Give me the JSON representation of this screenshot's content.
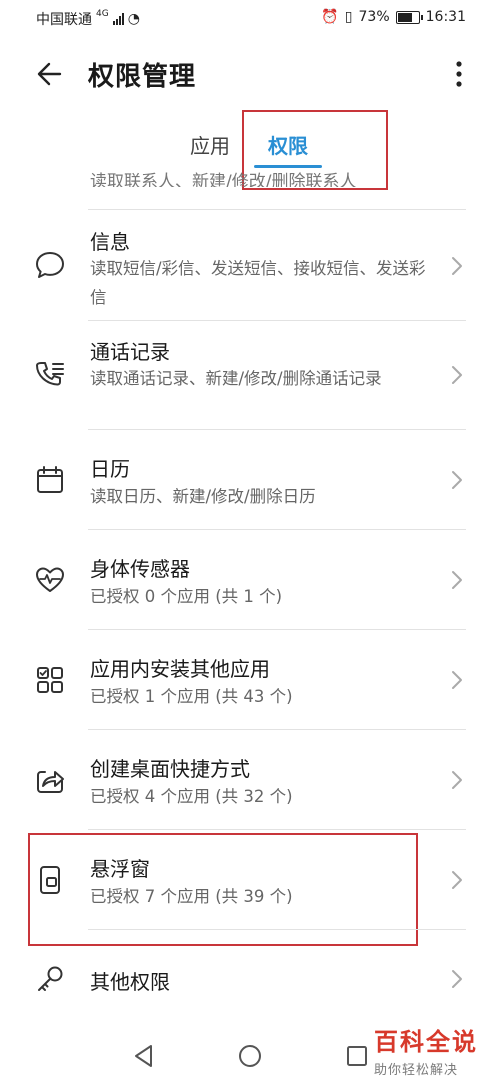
{
  "status_bar": {
    "carrier": "中国联通",
    "network": "4G",
    "battery": "73%",
    "battery_level": 0.73,
    "time": "16:31"
  },
  "header": {
    "title": "权限管理"
  },
  "tabs": [
    {
      "label": "应用",
      "selected": false
    },
    {
      "label": "权限",
      "selected": true
    }
  ],
  "list": {
    "cut_off_text": "读取联系人、新建/修改/删除联系人",
    "items": [
      {
        "icon": "message-icon",
        "title": "信息",
        "desc": "读取短信/彩信、发送短信、接收短信、发送彩信"
      },
      {
        "icon": "call-log-icon",
        "title": "通话记录",
        "desc": "读取通话记录、新建/修改/删除通话记录"
      },
      {
        "icon": "calendar-icon",
        "title": "日历",
        "desc": "读取日历、新建/修改/删除日历"
      },
      {
        "icon": "heart-sensor-icon",
        "title": "身体传感器",
        "desc": "已授权 0 个应用 (共 1 个)"
      },
      {
        "icon": "apps-grid-icon",
        "title": "应用内安装其他应用",
        "desc": "已授权 1 个应用 (共 43 个)"
      },
      {
        "icon": "shortcut-icon",
        "title": "创建桌面快捷方式",
        "desc": "已授权 4 个应用 (共 32 个)"
      },
      {
        "icon": "floating-window-icon",
        "title": "悬浮窗",
        "desc": "已授权 7 个应用 (共 39 个)"
      },
      {
        "icon": "key-icon",
        "title": "其他权限",
        "desc": ""
      }
    ]
  },
  "colors": {
    "accent": "#2a8fd4",
    "highlight": "#c8353a"
  },
  "watermark": {
    "main": "百科全说",
    "sub": "助你轻松解决"
  }
}
